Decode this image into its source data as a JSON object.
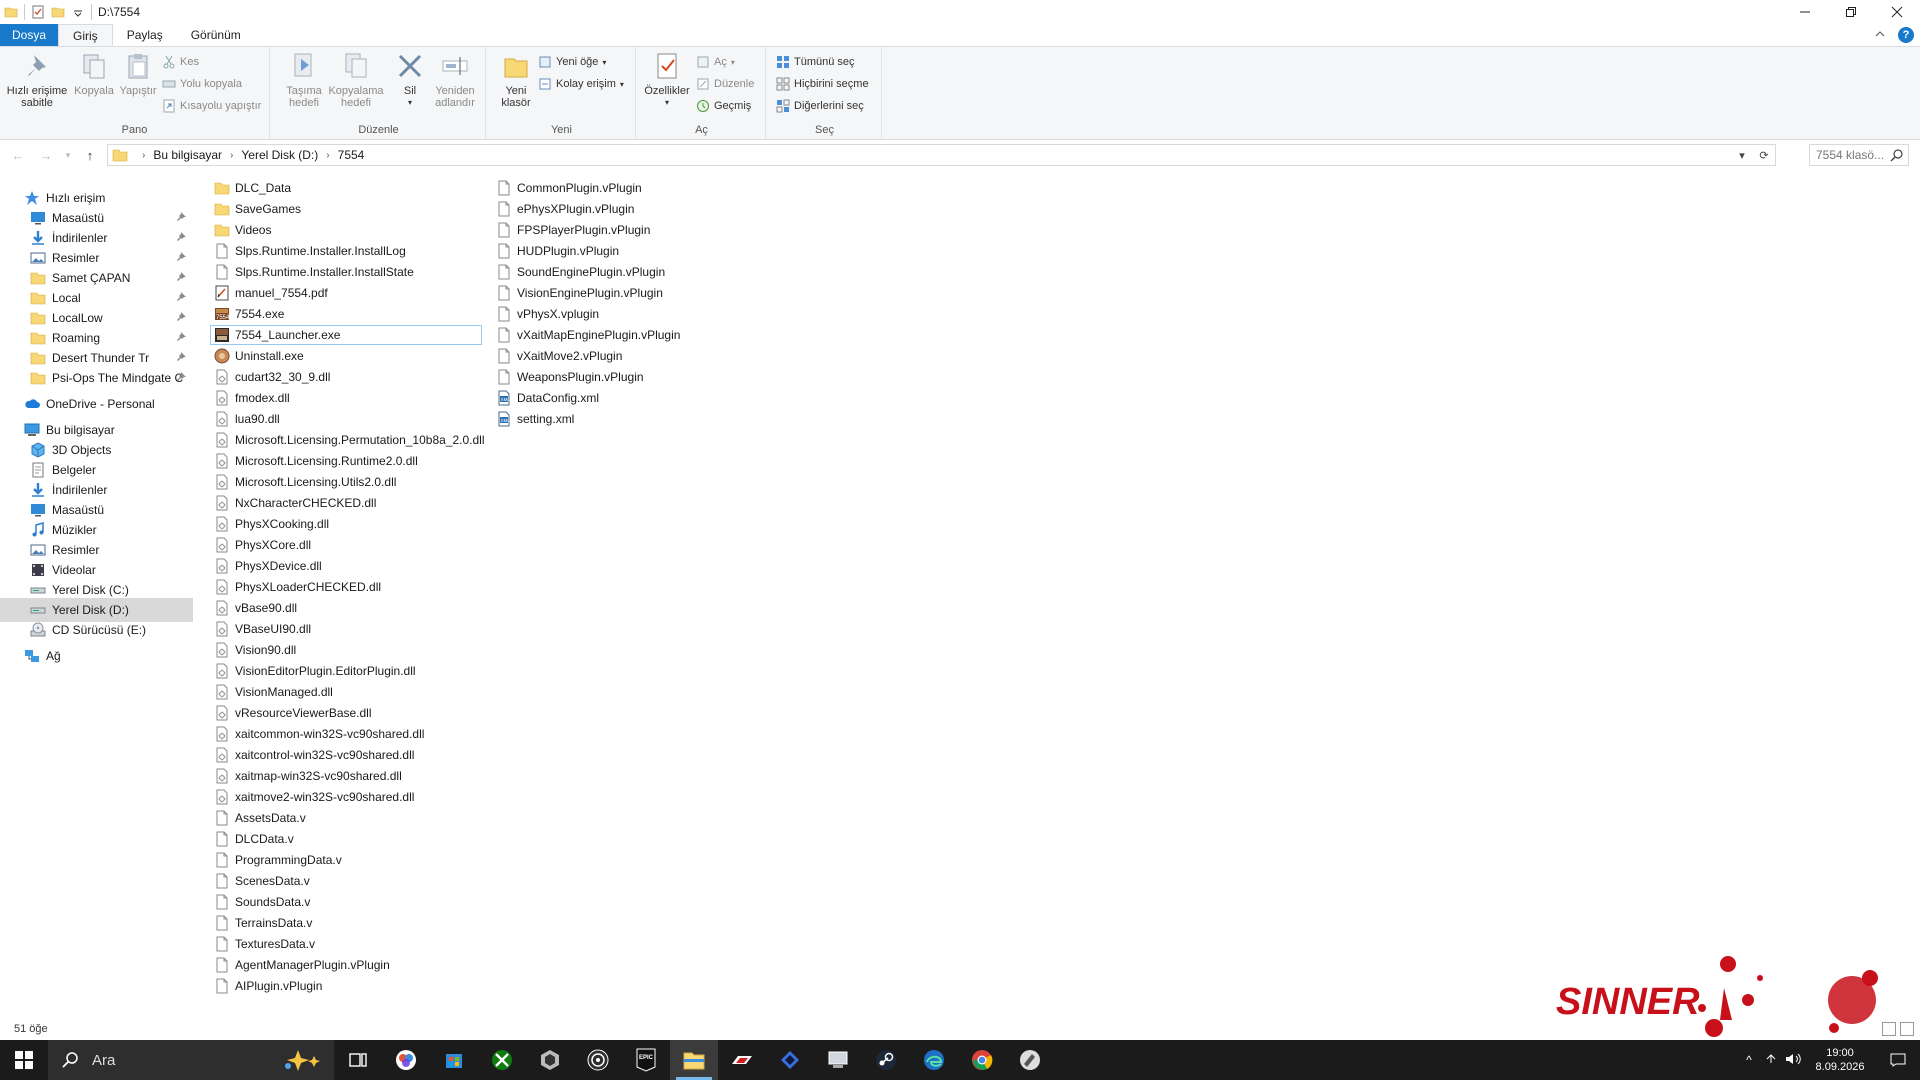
{
  "window": {
    "title": "D:\\7554"
  },
  "ribbon_tabs": [
    "Dosya",
    "Giriş",
    "Paylaş",
    "Görünüm"
  ],
  "ribbon": {
    "pano": {
      "label": "Pano",
      "pin_label_1": "Hızlı erişime",
      "pin_label_2": "sabitle",
      "copy": "Kopyala",
      "paste": "Yapıştır",
      "cut": "Kes",
      "copy_path": "Yolu kopyala",
      "paste_shortcut": "Kısayolu yapıştır"
    },
    "duzenle": {
      "label": "Düzenle",
      "move_1": "Taşıma",
      "move_2": "hedefi",
      "copyto_1": "Kopyalama",
      "copyto_2": "hedefi",
      "delete": "Sil",
      "rename_1": "Yeniden",
      "rename_2": "adlandır"
    },
    "yeni": {
      "label": "Yeni",
      "new_folder_1": "Yeni",
      "new_folder_2": "klasör",
      "new_item": "Yeni öğe",
      "easy_access": "Kolay erişim"
    },
    "ac": {
      "label": "Aç",
      "properties": "Özellikler",
      "open": "Aç",
      "edit": "Düzenle",
      "history": "Geçmiş"
    },
    "sec": {
      "label": "Seç",
      "select_all": "Tümünü seç",
      "select_none": "Hiçbirini seçme",
      "invert": "Diğerlerini seç"
    }
  },
  "address": {
    "crumbs": [
      "Bu bilgisayar",
      "Yerel Disk (D:)",
      "7554"
    ],
    "search_placeholder": "7554 klasö..."
  },
  "sidebar": {
    "items": [
      {
        "label": "Hızlı erişim",
        "icon": "star-icon"
      },
      {
        "label": "Masaüstü",
        "icon": "desktop-icon",
        "pinned": true
      },
      {
        "label": "İndirilenler",
        "icon": "download-icon",
        "pinned": true
      },
      {
        "label": "Resimler",
        "icon": "pictures-icon",
        "pinned": true
      },
      {
        "label": "Samet ÇAPAN",
        "icon": "folder-icon",
        "pinned": true
      },
      {
        "label": "Local",
        "icon": "folder-icon",
        "pinned": true
      },
      {
        "label": "LocalLow",
        "icon": "folder-icon",
        "pinned": true
      },
      {
        "label": "Roaming",
        "icon": "folder-icon",
        "pinned": true
      },
      {
        "label": "Desert Thunder Tr",
        "icon": "folder-icon",
        "pinned": true
      },
      {
        "label": "Psi-Ops The Mindgate C",
        "icon": "folder-icon",
        "pinned": true
      },
      {
        "label": "OneDrive - Personal",
        "icon": "cloud-icon"
      },
      {
        "label": "Bu bilgisayar",
        "icon": "computer-icon"
      },
      {
        "label": "3D Objects",
        "icon": "3d-objects-icon"
      },
      {
        "label": "Belgeler",
        "icon": "documents-icon"
      },
      {
        "label": "İndirilenler",
        "icon": "download-icon"
      },
      {
        "label": "Masaüstü",
        "icon": "desktop-icon"
      },
      {
        "label": "Müzikler",
        "icon": "music-icon"
      },
      {
        "label": "Resimler",
        "icon": "pictures-icon"
      },
      {
        "label": "Videolar",
        "icon": "videos-icon"
      },
      {
        "label": "Yerel Disk (C:)",
        "icon": "drive-icon"
      },
      {
        "label": "Yerel Disk (D:)",
        "icon": "drive-icon",
        "selected": true
      },
      {
        "label": "CD Sürücüsü (E:)",
        "icon": "cd-drive-icon"
      },
      {
        "label": "Ağ",
        "icon": "network-icon"
      }
    ]
  },
  "files": {
    "column1": [
      {
        "name": "DLC_Data",
        "icon": "folder-icon"
      },
      {
        "name": "SaveGames",
        "icon": "folder-icon"
      },
      {
        "name": "Videos",
        "icon": "folder-icon"
      },
      {
        "name": "Slps.Runtime.Installer.InstallLog",
        "icon": "file-icon"
      },
      {
        "name": "Slps.Runtime.Installer.InstallState",
        "icon": "file-icon"
      },
      {
        "name": "manuel_7554.pdf",
        "icon": "pdf-icon"
      },
      {
        "name": "7554.exe",
        "icon": "game-exe-icon"
      },
      {
        "name": "7554_Launcher.exe",
        "icon": "launcher-exe-icon",
        "focused": true
      },
      {
        "name": "Uninstall.exe",
        "icon": "uninstall-icon"
      },
      {
        "name": "cudart32_30_9.dll",
        "icon": "dll-icon"
      },
      {
        "name": "fmodex.dll",
        "icon": "dll-icon"
      },
      {
        "name": "lua90.dll",
        "icon": "dll-icon"
      },
      {
        "name": "Microsoft.Licensing.Permutation_10b8a_2.0.dll",
        "icon": "dll-icon"
      },
      {
        "name": "Microsoft.Licensing.Runtime2.0.dll",
        "icon": "dll-icon"
      },
      {
        "name": "Microsoft.Licensing.Utils2.0.dll",
        "icon": "dll-icon"
      },
      {
        "name": "NxCharacterCHECKED.dll",
        "icon": "dll-icon"
      },
      {
        "name": "PhysXCooking.dll",
        "icon": "dll-icon"
      },
      {
        "name": "PhysXCore.dll",
        "icon": "dll-icon"
      },
      {
        "name": "PhysXDevice.dll",
        "icon": "dll-icon"
      },
      {
        "name": "PhysXLoaderCHECKED.dll",
        "icon": "dll-icon"
      },
      {
        "name": "vBase90.dll",
        "icon": "dll-icon"
      },
      {
        "name": "VBaseUI90.dll",
        "icon": "dll-icon"
      },
      {
        "name": "Vision90.dll",
        "icon": "dll-icon"
      },
      {
        "name": "VisionEditorPlugin.EditorPlugin.dll",
        "icon": "dll-icon"
      },
      {
        "name": "VisionManaged.dll",
        "icon": "dll-icon"
      },
      {
        "name": "vResourceViewerBase.dll",
        "icon": "dll-icon"
      },
      {
        "name": "xaitcommon-win32S-vc90shared.dll",
        "icon": "dll-icon"
      },
      {
        "name": "xaitcontrol-win32S-vc90shared.dll",
        "icon": "dll-icon"
      },
      {
        "name": "xaitmap-win32S-vc90shared.dll",
        "icon": "dll-icon"
      },
      {
        "name": "xaitmove2-win32S-vc90shared.dll",
        "icon": "dll-icon"
      },
      {
        "name": "AssetsData.v",
        "icon": "file-icon"
      },
      {
        "name": "DLCData.v",
        "icon": "file-icon"
      },
      {
        "name": "ProgrammingData.v",
        "icon": "file-icon"
      },
      {
        "name": "ScenesData.v",
        "icon": "file-icon"
      },
      {
        "name": "SoundsData.v",
        "icon": "file-icon"
      },
      {
        "name": "TerrainsData.v",
        "icon": "file-icon"
      },
      {
        "name": "TexturesData.v",
        "icon": "file-icon"
      },
      {
        "name": "AgentManagerPlugin.vPlugin",
        "icon": "file-icon"
      },
      {
        "name": "AIPlugin.vPlugin",
        "icon": "file-icon"
      }
    ],
    "column2": [
      {
        "name": "CommonPlugin.vPlugin",
        "icon": "file-icon"
      },
      {
        "name": "ePhysXPlugin.vPlugin",
        "icon": "file-icon"
      },
      {
        "name": "FPSPlayerPlugin.vPlugin",
        "icon": "file-icon"
      },
      {
        "name": "HUDPlugin.vPlugin",
        "icon": "file-icon"
      },
      {
        "name": "SoundEnginePlugin.vPlugin",
        "icon": "file-icon"
      },
      {
        "name": "VisionEnginePlugin.vPlugin",
        "icon": "file-icon"
      },
      {
        "name": "vPhysX.vplugin",
        "icon": "file-icon"
      },
      {
        "name": "vXaitMapEnginePlugin.vPlugin",
        "icon": "file-icon"
      },
      {
        "name": "vXaitMove2.vPlugin",
        "icon": "file-icon"
      },
      {
        "name": "WeaponsPlugin.vPlugin",
        "icon": "file-icon"
      },
      {
        "name": "DataConfig.xml",
        "icon": "xml-icon"
      },
      {
        "name": "setting.xml",
        "icon": "xml-icon"
      }
    ]
  },
  "status": {
    "count": "51 öğe"
  },
  "watermark": {
    "text": "SINNER"
  },
  "taskbar": {
    "search_label": "Ara",
    "apps": [
      "task-view-icon",
      "davinci-icon",
      "store-icon",
      "xbox-icon",
      "epic-games-icon",
      "obs-icon",
      "epic-launcher-icon",
      "file-explorer-icon",
      "msi-afterburner-icon",
      "wireless-icon",
      "remote-desktop-icon",
      "steam-icon",
      "edge-icon",
      "chrome-icon",
      "game-tool-icon"
    ],
    "active_app": "file-explorer-icon",
    "time": "19:00",
    "date": "8.09.2026"
  },
  "colors": {
    "accent": "#1979ca",
    "folder": "#f8d775",
    "selection": "#d9d9d9",
    "taskbar": "#1b1b1b",
    "watermark": "#c8101a"
  }
}
